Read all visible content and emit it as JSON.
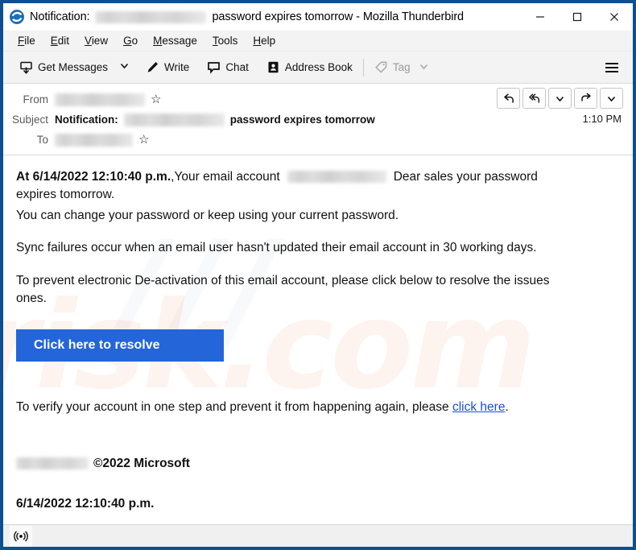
{
  "window": {
    "title_prefix": "Notification:",
    "title_suffix": "password expires tomorrow - Mozilla Thunderbird",
    "app_icon": "thunderbird-icon",
    "controls": {
      "minimize": "minimize-icon",
      "maximize": "maximize-icon",
      "close": "close-icon"
    }
  },
  "menubar": {
    "items": [
      {
        "label": "File",
        "accesskey": "F"
      },
      {
        "label": "Edit",
        "accesskey": "E"
      },
      {
        "label": "View",
        "accesskey": "V"
      },
      {
        "label": "Go",
        "accesskey": "G"
      },
      {
        "label": "Message",
        "accesskey": "M"
      },
      {
        "label": "Tools",
        "accesskey": "T"
      },
      {
        "label": "Help",
        "accesskey": "H"
      }
    ]
  },
  "toolbar": {
    "get_messages": "Get Messages",
    "get_messages_icon": "get-messages-icon",
    "get_messages_chevron": "chevron-down-icon",
    "write": "Write",
    "write_icon": "pencil-icon",
    "chat": "Chat",
    "chat_icon": "chat-bubble-icon",
    "address_book": "Address Book",
    "address_book_icon": "address-book-icon",
    "tag": "Tag",
    "tag_icon": "tag-icon",
    "tag_chevron": "chevron-down-icon",
    "tag_disabled": true,
    "app_menu_icon": "hamburger-menu-icon"
  },
  "message_header": {
    "from_label": "From",
    "from_value_redacted": true,
    "from_star_icon": "star-icon",
    "subject_label": "Subject",
    "subject_bold_prefix": "Notification:",
    "subject_redacted": true,
    "subject_rest": "password expires tomorrow",
    "to_label": "To",
    "to_value_redacted": true,
    "to_star_icon": "star-icon",
    "time": "1:10 PM",
    "actions": [
      {
        "name": "reply-button",
        "icon": "reply-icon"
      },
      {
        "name": "reply-all-button",
        "icon": "reply-all-icon"
      },
      {
        "name": "reply-more-button",
        "icon": "chevron-down-icon"
      },
      {
        "name": "forward-button",
        "icon": "forward-arrow-icon"
      },
      {
        "name": "more-actions-button",
        "icon": "chevron-down-icon"
      }
    ]
  },
  "body": {
    "watermark_1": "risk.com",
    "watermark_2": "///",
    "line1_bold": "At 6/14/2022 12:10:40 p.m.",
    "line1_mid": ",Your email account",
    "line1_after_redact": "Dear sales your password",
    "line2": "expires tomorrow.",
    "line3": "You can change your password or keep using your current password.",
    "line4": "Sync failures occur when an email user hasn't updated their email account in 30 working  days.",
    "line5": " To prevent electronic De-activation of this email account, please click below to resolve the issues",
    "line6": "ones.",
    "cta_label": "Click here to resolve",
    "cta_color": "#2465da",
    "verify_text_before": "To verify your account in one step and prevent it from happening again, please ",
    "verify_link": "click here",
    "verify_text_after": ".",
    "link_color": "#1a4fcf",
    "signature_redacted": true,
    "signature_text": "©2022 Microsoft",
    "timestamp": "6/14/2022 12:10:40 p.m."
  },
  "statusbar": {
    "icon": "broadcast-signal-icon"
  }
}
